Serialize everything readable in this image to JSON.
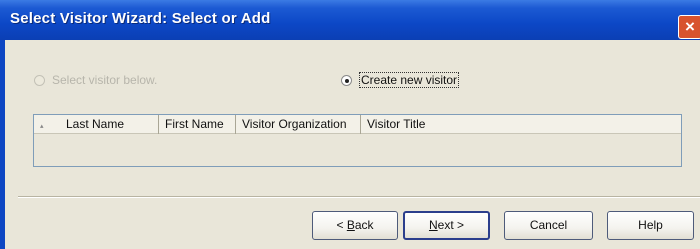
{
  "window": {
    "title": "Select Visitor Wizard: Select or Add",
    "close_glyph": "×"
  },
  "options": {
    "select_label": "Select visitor below.",
    "create_label": "Create new visitor",
    "selected": "create"
  },
  "table": {
    "sort_glyph": "▴",
    "columns": [
      "Last Name",
      "First Name",
      "Visitor Organization",
      "Visitor Title"
    ],
    "rows": []
  },
  "buttons": {
    "back": {
      "pre": "< ",
      "key": "B",
      "post": "ack"
    },
    "next": {
      "key": "N",
      "post": "ext >"
    },
    "cancel": "Cancel",
    "help": "Help"
  }
}
